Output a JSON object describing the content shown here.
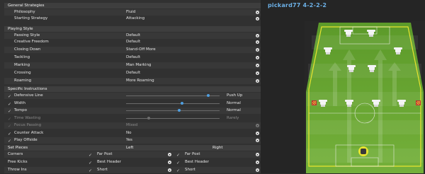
{
  "app": {
    "accent": "#4f9fe0",
    "pitch_color": "#6aa632",
    "line_color": "#e8e430"
  },
  "general": {
    "header": "General Strategies",
    "rows": [
      {
        "label": "Philosophy",
        "value": "Fluid"
      },
      {
        "label": "Starting Strategy",
        "value": "Attacking"
      }
    ]
  },
  "playing_style": {
    "header": "Playing Style",
    "rows": [
      {
        "label": "Passing Style",
        "value": "Default"
      },
      {
        "label": "Creative Freedom",
        "value": "Default"
      },
      {
        "label": "Closing Down",
        "value": "Stand-Off More"
      },
      {
        "label": "Tackling",
        "value": "Default"
      },
      {
        "label": "Marking",
        "value": "Man Marking"
      },
      {
        "label": "Crossing",
        "value": "Default"
      },
      {
        "label": "Roaming",
        "value": "More Roaming"
      }
    ]
  },
  "specific": {
    "header": "Specific Instructions",
    "rows": [
      {
        "label": "Defensive Line",
        "checked": true,
        "type": "slider",
        "level": 0.88,
        "value": "Push Up"
      },
      {
        "label": "Width",
        "checked": true,
        "type": "slider",
        "level": 0.6,
        "value": "Normal"
      },
      {
        "label": "Tempo",
        "checked": true,
        "type": "slider",
        "level": 0.57,
        "value": "Normal"
      },
      {
        "label": "Time Wasting",
        "checked": false,
        "type": "slider",
        "level": 0.24,
        "value": "Rarely"
      },
      {
        "label": "Focus Passing",
        "checked": false,
        "type": "dropdown",
        "value": "Mixed"
      },
      {
        "label": "Counter Attack",
        "checked": true,
        "type": "dropdown",
        "value": "No"
      },
      {
        "label": "Play Offside",
        "checked": true,
        "type": "dropdown",
        "value": "Yes"
      }
    ]
  },
  "set_pieces": {
    "header": "Set Pieces",
    "col_left": "Left",
    "col_right": "Right",
    "rows": [
      {
        "label": "Corners",
        "left": "Far Post",
        "right": "Far Post"
      },
      {
        "label": "Free Kicks",
        "left": "Best Header",
        "right": "Best Header"
      },
      {
        "label": "Throw Ins",
        "left": "Short",
        "right": "Short"
      }
    ]
  },
  "tactic": {
    "title": "pickard77 4-2-2-2"
  },
  "icons": {
    "dropdown": "chevron-down-icon",
    "check": "check-icon",
    "player": "shirt-icon",
    "flag": "corner-flag-icon"
  }
}
